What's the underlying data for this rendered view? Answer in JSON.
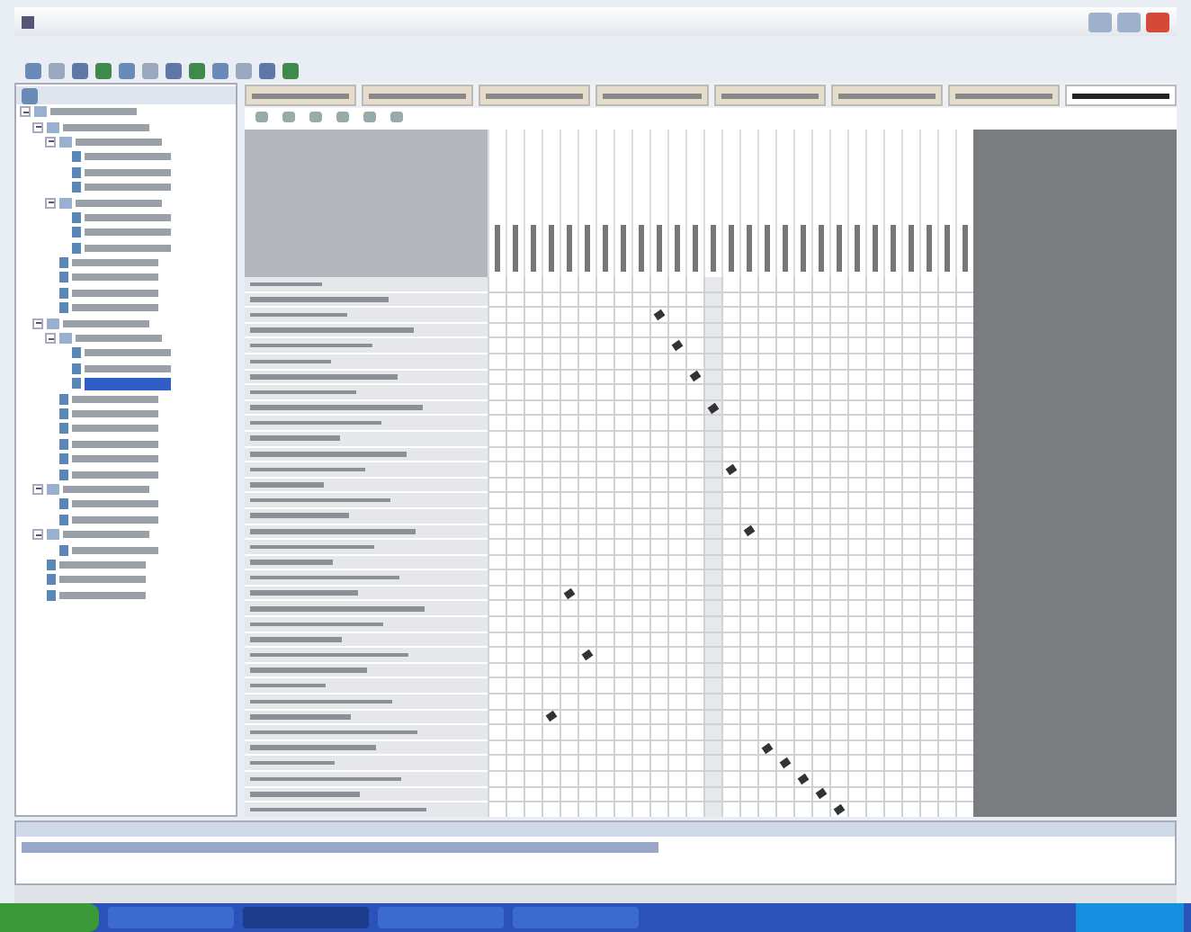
{
  "tree": [
    {
      "selected": false,
      "expanded": true,
      "kind": "folder",
      "children": [
        {
          "selected": false,
          "expanded": true,
          "kind": "folder",
          "children": [
            {
              "selected": false,
              "expanded": true,
              "kind": "folder",
              "children": [
                {
                  "selected": false,
                  "kind": "doc"
                },
                {
                  "selected": false,
                  "kind": "doc"
                },
                {
                  "selected": false,
                  "kind": "doc"
                }
              ]
            },
            {
              "selected": false,
              "expanded": true,
              "kind": "folder",
              "children": [
                {
                  "selected": false,
                  "kind": "doc"
                },
                {
                  "selected": false,
                  "kind": "doc"
                },
                {
                  "selected": false,
                  "kind": "doc"
                }
              ]
            },
            {
              "selected": false,
              "kind": "doc"
            },
            {
              "selected": false,
              "kind": "doc"
            },
            {
              "selected": false,
              "kind": "doc"
            },
            {
              "selected": false,
              "kind": "doc"
            }
          ]
        },
        {
          "selected": false,
          "expanded": true,
          "kind": "folder",
          "children": [
            {
              "selected": false,
              "expanded": true,
              "kind": "folder",
              "children": [
                {
                  "selected": false,
                  "kind": "doc"
                },
                {
                  "selected": false,
                  "kind": "doc"
                },
                {
                  "selected": true,
                  "kind": "doc"
                }
              ]
            },
            {
              "selected": false,
              "kind": "doc"
            },
            {
              "selected": false,
              "kind": "doc"
            },
            {
              "selected": false,
              "kind": "doc"
            },
            {
              "selected": false,
              "kind": "doc"
            },
            {
              "selected": false,
              "kind": "doc"
            },
            {
              "selected": false,
              "kind": "doc"
            }
          ]
        },
        {
          "selected": false,
          "expanded": true,
          "kind": "folder",
          "children": [
            {
              "selected": false,
              "kind": "doc"
            },
            {
              "selected": false,
              "kind": "doc"
            }
          ]
        },
        {
          "selected": false,
          "expanded": true,
          "kind": "folder",
          "children": [
            {
              "selected": false,
              "kind": "doc"
            }
          ]
        },
        {
          "selected": false,
          "kind": "doc"
        },
        {
          "selected": false,
          "kind": "doc"
        },
        {
          "selected": false,
          "kind": "doc"
        }
      ]
    }
  ],
  "tabs": [
    {
      "selected": false
    },
    {
      "selected": false
    },
    {
      "selected": false
    },
    {
      "selected": false
    },
    {
      "selected": false
    },
    {
      "selected": false
    },
    {
      "selected": false
    },
    {
      "selected": true
    }
  ],
  "rows": [
    {
      "cells": [
        false,
        false,
        false,
        false,
        false,
        false,
        false,
        false,
        false,
        false,
        false,
        false,
        false,
        false,
        false,
        false,
        false,
        false,
        false,
        false,
        false,
        false,
        false,
        false,
        false,
        false,
        false
      ]
    },
    {
      "cells": [
        false,
        false,
        false,
        false,
        false,
        false,
        false,
        false,
        false,
        false,
        false,
        false,
        false,
        false,
        false,
        false,
        false,
        false,
        false,
        false,
        false,
        false,
        false,
        false,
        false,
        false,
        false
      ]
    },
    {
      "cells": [
        false,
        false,
        false,
        false,
        false,
        false,
        false,
        false,
        false,
        true,
        false,
        false,
        false,
        false,
        false,
        false,
        false,
        false,
        false,
        false,
        false,
        false,
        false,
        false,
        false,
        false,
        false
      ]
    },
    {
      "cells": [
        false,
        false,
        false,
        false,
        false,
        false,
        false,
        false,
        false,
        false,
        false,
        false,
        false,
        false,
        false,
        false,
        false,
        false,
        false,
        false,
        false,
        false,
        false,
        false,
        false,
        false,
        false
      ]
    },
    {
      "cells": [
        false,
        false,
        false,
        false,
        false,
        false,
        false,
        false,
        false,
        false,
        true,
        false,
        false,
        false,
        false,
        false,
        false,
        false,
        false,
        false,
        false,
        false,
        false,
        false,
        false,
        false,
        false
      ]
    },
    {
      "cells": [
        false,
        false,
        false,
        false,
        false,
        false,
        false,
        false,
        false,
        false,
        false,
        false,
        false,
        false,
        false,
        false,
        false,
        false,
        false,
        false,
        false,
        false,
        false,
        false,
        false,
        false,
        false
      ]
    },
    {
      "cells": [
        false,
        false,
        false,
        false,
        false,
        false,
        false,
        false,
        false,
        false,
        false,
        true,
        false,
        false,
        false,
        false,
        false,
        false,
        false,
        false,
        false,
        false,
        false,
        false,
        false,
        false,
        false
      ]
    },
    {
      "cells": [
        false,
        false,
        false,
        false,
        false,
        false,
        false,
        false,
        false,
        false,
        false,
        false,
        false,
        false,
        false,
        false,
        false,
        false,
        false,
        false,
        false,
        false,
        false,
        false,
        false,
        false,
        false
      ]
    },
    {
      "cells": [
        false,
        false,
        false,
        false,
        false,
        false,
        false,
        false,
        false,
        false,
        false,
        false,
        true,
        false,
        false,
        false,
        false,
        false,
        false,
        false,
        false,
        false,
        false,
        false,
        false,
        false,
        false
      ]
    },
    {
      "cells": [
        false,
        false,
        false,
        false,
        false,
        false,
        false,
        false,
        false,
        false,
        false,
        false,
        false,
        false,
        false,
        false,
        false,
        false,
        false,
        false,
        false,
        false,
        false,
        false,
        false,
        false,
        false
      ]
    },
    {
      "cells": [
        false,
        false,
        false,
        false,
        false,
        false,
        false,
        false,
        false,
        false,
        false,
        false,
        false,
        false,
        false,
        false,
        false,
        false,
        false,
        false,
        false,
        false,
        false,
        false,
        false,
        false,
        false
      ]
    },
    {
      "cells": [
        false,
        false,
        false,
        false,
        false,
        false,
        false,
        false,
        false,
        false,
        false,
        false,
        false,
        false,
        false,
        false,
        false,
        false,
        false,
        false,
        false,
        false,
        false,
        false,
        false,
        false,
        false
      ]
    },
    {
      "cells": [
        false,
        false,
        false,
        false,
        false,
        false,
        false,
        false,
        false,
        false,
        false,
        false,
        false,
        true,
        false,
        false,
        false,
        false,
        false,
        false,
        false,
        false,
        false,
        false,
        false,
        false,
        false
      ]
    },
    {
      "cells": [
        false,
        false,
        false,
        false,
        false,
        false,
        false,
        false,
        false,
        false,
        false,
        false,
        false,
        false,
        false,
        false,
        false,
        false,
        false,
        false,
        false,
        false,
        false,
        false,
        false,
        false,
        false
      ]
    },
    {
      "cells": [
        false,
        false,
        false,
        false,
        false,
        false,
        false,
        false,
        false,
        false,
        false,
        false,
        false,
        false,
        false,
        false,
        false,
        false,
        false,
        false,
        false,
        false,
        false,
        false,
        false,
        false,
        false
      ]
    },
    {
      "cells": [
        false,
        false,
        false,
        false,
        false,
        false,
        false,
        false,
        false,
        false,
        false,
        false,
        false,
        false,
        false,
        false,
        false,
        false,
        false,
        false,
        false,
        false,
        false,
        false,
        false,
        false,
        false
      ]
    },
    {
      "cells": [
        false,
        false,
        false,
        false,
        false,
        false,
        false,
        false,
        false,
        false,
        false,
        false,
        false,
        false,
        true,
        false,
        false,
        false,
        false,
        false,
        false,
        false,
        false,
        false,
        false,
        false,
        false
      ]
    },
    {
      "cells": [
        false,
        false,
        false,
        false,
        false,
        false,
        false,
        false,
        false,
        false,
        false,
        false,
        false,
        false,
        false,
        false,
        false,
        false,
        false,
        false,
        false,
        false,
        false,
        false,
        false,
        false,
        false
      ]
    },
    {
      "cells": [
        false,
        false,
        false,
        false,
        false,
        false,
        false,
        false,
        false,
        false,
        false,
        false,
        false,
        false,
        false,
        false,
        false,
        false,
        false,
        false,
        false,
        false,
        false,
        false,
        false,
        false,
        false
      ]
    },
    {
      "cells": [
        false,
        false,
        false,
        false,
        false,
        false,
        false,
        false,
        false,
        false,
        false,
        false,
        false,
        false,
        false,
        false,
        false,
        false,
        false,
        false,
        false,
        false,
        false,
        false,
        false,
        false,
        false
      ]
    },
    {
      "cells": [
        false,
        false,
        false,
        false,
        true,
        false,
        false,
        false,
        false,
        false,
        false,
        false,
        false,
        false,
        false,
        false,
        false,
        false,
        false,
        false,
        false,
        false,
        false,
        false,
        false,
        false,
        false
      ]
    },
    {
      "cells": [
        false,
        false,
        false,
        false,
        false,
        false,
        false,
        false,
        false,
        false,
        false,
        false,
        false,
        false,
        false,
        false,
        false,
        false,
        false,
        false,
        false,
        false,
        false,
        false,
        false,
        false,
        false
      ]
    },
    {
      "cells": [
        false,
        false,
        false,
        false,
        false,
        false,
        false,
        false,
        false,
        false,
        false,
        false,
        false,
        false,
        false,
        false,
        false,
        false,
        false,
        false,
        false,
        false,
        false,
        false,
        false,
        false,
        false
      ]
    },
    {
      "cells": [
        false,
        false,
        false,
        false,
        false,
        false,
        false,
        false,
        false,
        false,
        false,
        false,
        false,
        false,
        false,
        false,
        false,
        false,
        false,
        false,
        false,
        false,
        false,
        false,
        false,
        false,
        false
      ]
    },
    {
      "cells": [
        false,
        false,
        false,
        false,
        false,
        true,
        false,
        false,
        false,
        false,
        false,
        false,
        false,
        false,
        false,
        false,
        false,
        false,
        false,
        false,
        false,
        false,
        false,
        false,
        false,
        false,
        false
      ]
    },
    {
      "cells": [
        false,
        false,
        false,
        false,
        false,
        false,
        false,
        false,
        false,
        false,
        false,
        false,
        false,
        false,
        false,
        false,
        false,
        false,
        false,
        false,
        false,
        false,
        false,
        false,
        false,
        false,
        false
      ]
    },
    {
      "cells": [
        false,
        false,
        false,
        false,
        false,
        false,
        false,
        false,
        false,
        false,
        false,
        false,
        false,
        false,
        false,
        false,
        false,
        false,
        false,
        false,
        false,
        false,
        false,
        false,
        false,
        false,
        false
      ]
    },
    {
      "cells": [
        false,
        false,
        false,
        false,
        false,
        false,
        false,
        false,
        false,
        false,
        false,
        false,
        false,
        false,
        false,
        false,
        false,
        false,
        false,
        false,
        false,
        false,
        false,
        false,
        false,
        false,
        false
      ]
    },
    {
      "cells": [
        false,
        false,
        false,
        true,
        false,
        false,
        false,
        false,
        false,
        false,
        false,
        false,
        false,
        false,
        false,
        false,
        false,
        false,
        false,
        false,
        false,
        false,
        false,
        false,
        false,
        false,
        false
      ]
    },
    {
      "cells": [
        false,
        false,
        false,
        false,
        false,
        false,
        false,
        false,
        false,
        false,
        false,
        false,
        false,
        false,
        false,
        false,
        false,
        false,
        false,
        false,
        false,
        false,
        false,
        false,
        false,
        false,
        false
      ]
    },
    {
      "cells": [
        false,
        false,
        false,
        false,
        false,
        false,
        false,
        false,
        false,
        false,
        false,
        false,
        false,
        false,
        false,
        true,
        false,
        false,
        false,
        false,
        false,
        false,
        false,
        false,
        false,
        false,
        false
      ]
    },
    {
      "cells": [
        false,
        false,
        false,
        false,
        false,
        false,
        false,
        false,
        false,
        false,
        false,
        false,
        false,
        false,
        false,
        false,
        true,
        false,
        false,
        false,
        false,
        false,
        false,
        false,
        false,
        false,
        false
      ]
    },
    {
      "cells": [
        false,
        false,
        false,
        false,
        false,
        false,
        false,
        false,
        false,
        false,
        false,
        false,
        false,
        false,
        false,
        false,
        false,
        true,
        false,
        false,
        false,
        false,
        false,
        false,
        false,
        false,
        false
      ]
    },
    {
      "cells": [
        false,
        false,
        false,
        false,
        false,
        false,
        false,
        false,
        false,
        false,
        false,
        false,
        false,
        false,
        false,
        false,
        false,
        false,
        true,
        false,
        false,
        false,
        false,
        false,
        false,
        false,
        false
      ]
    },
    {
      "cells": [
        false,
        false,
        false,
        false,
        false,
        false,
        false,
        false,
        false,
        false,
        false,
        false,
        false,
        false,
        false,
        false,
        false,
        false,
        false,
        true,
        false,
        false,
        false,
        false,
        false,
        false,
        false
      ]
    }
  ],
  "taskbar": {
    "tasks": [
      {
        "selected": false
      },
      {
        "selected": true
      },
      {
        "selected": false
      },
      {
        "selected": false
      }
    ]
  }
}
